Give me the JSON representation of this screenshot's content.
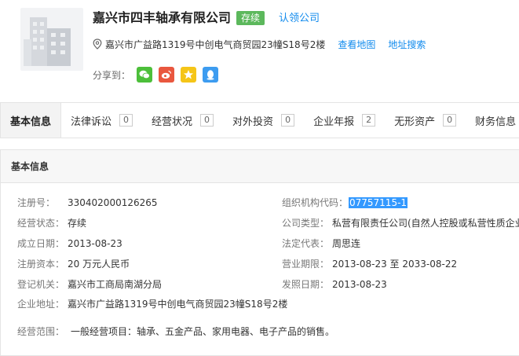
{
  "company": {
    "name": "嘉兴市四丰轴承有限公司",
    "status": "存续",
    "claim": "认领公司",
    "address": "嘉兴市广益路1319号中创电气商贸园23幢S18号2楼",
    "view_map": "查看地图",
    "address_search": "地址搜索",
    "share_label": "分享到："
  },
  "tabs": [
    {
      "label": "基本信息",
      "count": ""
    },
    {
      "label": "法律诉讼",
      "count": "0"
    },
    {
      "label": "经营状况",
      "count": "0"
    },
    {
      "label": "对外投资",
      "count": "0"
    },
    {
      "label": "企业年报",
      "count": "2"
    },
    {
      "label": "无形资产",
      "count": "0"
    },
    {
      "label": "财务信息",
      "count": ""
    }
  ],
  "basic": {
    "section_title": "基本信息",
    "reg_no_label": "注册号：",
    "reg_no": "330402000126265",
    "org_code_label": "组织机构代码：",
    "org_code": "07757115-1",
    "biz_status_label": "经营状态：",
    "biz_status": "存续",
    "company_type_label": "公司类型：",
    "company_type": "私营有限责任公司(自然人控股或私营性质企业",
    "founded_label": "成立日期：",
    "founded": "2013-08-23",
    "legal_rep_label": "法定代表：",
    "legal_rep": "周思连",
    "capital_label": "注册资本：",
    "capital": "20 万元人民币",
    "biz_term_label": "营业期限：",
    "biz_term": "2013-08-23 至 2033-08-22",
    "authority_label": "登记机关：",
    "authority": "嘉兴市工商局南湖分局",
    "issue_date_label": "发照日期：",
    "issue_date": "2013-08-23",
    "address_label": "企业地址：",
    "address": "嘉兴市广益路1319号中创电气商贸园23幢S18号2楼",
    "scope_label": "经营范围：",
    "scope": "一般经营项目：轴承、五金产品、家用电器、电子产品的销售。"
  },
  "colors": {
    "status_green": "#5cb85c",
    "link_blue": "#128bed",
    "selection_blue": "#3399ff",
    "wechat": "#4cbf3a",
    "weibo": "#e9573f",
    "qzone": "#f5c518",
    "qq": "#3d9cf0"
  }
}
